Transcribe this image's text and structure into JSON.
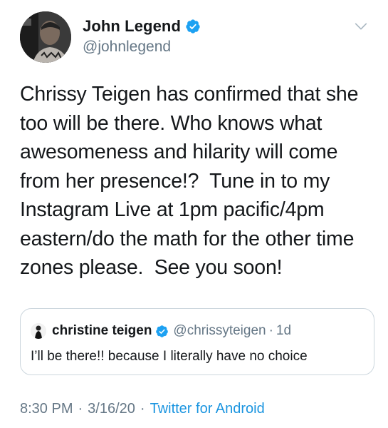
{
  "author": {
    "display_name": "John Legend",
    "handle": "@johnlegend",
    "verified": true
  },
  "tweet": {
    "text": "Chrissy Teigen has confirmed that she\ntoo will be there. Who knows what\nawesomeness and hilarity will come\nfrom her presence!?  Tune in to my\nInstagram Live at 1pm pacific/4pm\neastern/do the math for the other time\nzones please.  See you soon!"
  },
  "quoted_tweet": {
    "display_name": "christine teigen",
    "handle": "@chrissyteigen",
    "separator": "·",
    "time": "1d",
    "text": "I’ll be there!! because I literally have no choice"
  },
  "footer": {
    "time": "8:30 PM",
    "separator1": "·",
    "date": "3/16/20",
    "separator2": "·",
    "source": "Twitter for Android"
  },
  "colors": {
    "verified_blue": "#1da1f2",
    "link_blue": "#1b95e0",
    "secondary_gray": "#657786",
    "border_gray": "#ccd6dd"
  },
  "icons": {
    "verified": "verified-badge-icon",
    "more": "chevron-down-icon"
  }
}
